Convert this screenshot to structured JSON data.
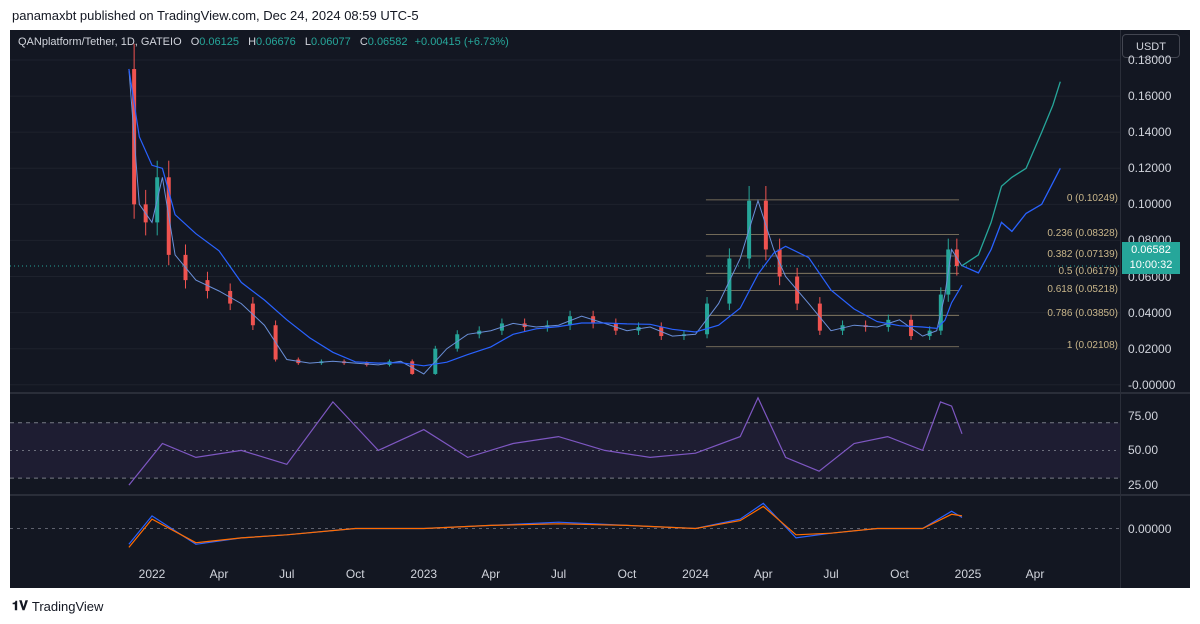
{
  "header": {
    "published": "panamaxbt published on TradingView.com, Dec 24, 2024 08:59 UTC-5"
  },
  "legend": {
    "symbol": "QANplatform/Tether, 1D, GATEIO",
    "o_label": "O",
    "o_value": "0.06125",
    "h_label": "H",
    "h_value": "0.06676",
    "l_label": "L",
    "l_value": "0.06077",
    "c_label": "C",
    "c_value": "0.06582",
    "change": "+0.00415 (+6.73%)"
  },
  "currency_button": "USDT",
  "price_box": {
    "price": "0.06582",
    "countdown": "10:00:32"
  },
  "footer": {
    "logo_text": "TradingView"
  },
  "colors": {
    "background": "#131722",
    "up": "#26a69a",
    "down": "#ef5350",
    "rsi": "#7e57c2",
    "fib": "#c9b68a"
  },
  "chart_data": [
    {
      "type": "candlestick",
      "symbol": "QANplatform/Tether",
      "x_ticks": [
        "2022",
        "Apr",
        "Jul",
        "Oct",
        "2023",
        "Apr",
        "Jul",
        "Oct",
        "2024",
        "Apr",
        "Jul",
        "Oct",
        "2025",
        "Apr"
      ],
      "y_ticks": [
        "0.18000",
        "0.16000",
        "0.14000",
        "0.12000",
        "0.10000",
        "0.08000",
        "0.06000",
        "0.04000",
        "0.02000",
        "-0.00000"
      ],
      "ylim": [
        -0.004,
        0.18
      ],
      "price_series": {
        "x": [
          "2021-12-01",
          "2021-12-15",
          "2022-01-01",
          "2022-01-15",
          "2022-02-01",
          "2022-03-01",
          "2022-04-01",
          "2022-05-01",
          "2022-06-01",
          "2022-07-01",
          "2022-08-01",
          "2022-09-01",
          "2022-10-01",
          "2022-11-01",
          "2022-12-01",
          "2023-01-01",
          "2023-02-01",
          "2023-03-01",
          "2023-04-01",
          "2023-05-01",
          "2023-06-01",
          "2023-07-01",
          "2023-08-01",
          "2023-09-01",
          "2023-10-01",
          "2023-11-01",
          "2023-12-01",
          "2024-01-01",
          "2024-02-01",
          "2024-03-01",
          "2024-03-25",
          "2024-04-15",
          "2024-05-01",
          "2024-06-01",
          "2024-07-01",
          "2024-08-01",
          "2024-09-01",
          "2024-10-01",
          "2024-11-01",
          "2024-11-20",
          "2024-12-01",
          "2024-12-10",
          "2024-12-24"
        ],
        "close": [
          0.175,
          0.1,
          0.09,
          0.115,
          0.072,
          0.058,
          0.052,
          0.045,
          0.033,
          0.014,
          0.012,
          0.013,
          0.012,
          0.011,
          0.013,
          0.006,
          0.02,
          0.028,
          0.03,
          0.034,
          0.032,
          0.033,
          0.038,
          0.034,
          0.03,
          0.032,
          0.027,
          0.028,
          0.045,
          0.07,
          0.102,
          0.075,
          0.06,
          0.045,
          0.03,
          0.033,
          0.032,
          0.036,
          0.027,
          0.03,
          0.05,
          0.075,
          0.0658
        ]
      },
      "projection": {
        "x": [
          "2024-12-24",
          "2025-01-15",
          "2025-02-01",
          "2025-02-15",
          "2025-03-01",
          "2025-03-20",
          "2025-04-10",
          "2025-04-25",
          "2025-05-05"
        ],
        "path_1": [
          0.066,
          0.072,
          0.09,
          0.11,
          0.115,
          0.12,
          0.14,
          0.155,
          0.168
        ],
        "path_2": [
          0.066,
          0.062,
          0.075,
          0.09,
          0.085,
          0.095,
          0.1,
          0.112,
          0.12
        ]
      },
      "fibonacci": [
        {
          "level": "0",
          "price": "0.10249"
        },
        {
          "level": "0.236",
          "price": "0.08328"
        },
        {
          "level": "0.382",
          "price": "0.07139"
        },
        {
          "level": "0.5",
          "price": "0.06179"
        },
        {
          "level": "0.618",
          "price": "0.05218"
        },
        {
          "level": "0.786",
          "price": "0.03850"
        },
        {
          "level": "1",
          "price": "0.02108"
        }
      ],
      "last_price": 0.06582
    },
    {
      "type": "line",
      "indicator": "RSI",
      "y_ticks": [
        "75.00",
        "50.00",
        "25.00"
      ],
      "ylim": [
        20,
        90
      ],
      "bands": [
        70,
        30
      ],
      "x": [
        "2021-12-01",
        "2022-01-15",
        "2022-03-01",
        "2022-05-01",
        "2022-07-01",
        "2022-09-01",
        "2022-11-01",
        "2023-01-01",
        "2023-03-01",
        "2023-05-01",
        "2023-07-01",
        "2023-09-01",
        "2023-11-01",
        "2024-01-01",
        "2024-03-01",
        "2024-03-25",
        "2024-05-01",
        "2024-06-15",
        "2024-08-01",
        "2024-09-15",
        "2024-11-01",
        "2024-11-25",
        "2024-12-10",
        "2024-12-24"
      ],
      "values": [
        25,
        55,
        45,
        50,
        40,
        85,
        50,
        65,
        45,
        55,
        60,
        50,
        45,
        48,
        60,
        88,
        45,
        35,
        55,
        60,
        50,
        85,
        82,
        62
      ]
    },
    {
      "type": "line",
      "indicator": "MACD",
      "y_ticks": [
        "0.00000"
      ],
      "ylim": [
        -0.02,
        0.02
      ],
      "x": [
        "2021-12-01",
        "2022-01-01",
        "2022-03-01",
        "2022-05-01",
        "2022-07-01",
        "2022-10-01",
        "2023-01-01",
        "2023-04-01",
        "2023-07-01",
        "2023-10-01",
        "2024-01-01",
        "2024-03-01",
        "2024-04-01",
        "2024-05-15",
        "2024-07-01",
        "2024-09-01",
        "2024-11-01",
        "2024-12-10",
        "2024-12-24"
      ],
      "macd": [
        -0.01,
        0.008,
        -0.01,
        -0.006,
        -0.004,
        0.0,
        0.0,
        0.002,
        0.004,
        0.002,
        0.0,
        0.006,
        0.016,
        -0.006,
        -0.003,
        0.0,
        0.0,
        0.011,
        0.007
      ],
      "signal": [
        -0.012,
        0.006,
        -0.009,
        -0.006,
        -0.004,
        0.0,
        0.0,
        0.002,
        0.003,
        0.002,
        0.0,
        0.005,
        0.014,
        -0.004,
        -0.003,
        0.0,
        0.0,
        0.009,
        0.008
      ]
    }
  ]
}
